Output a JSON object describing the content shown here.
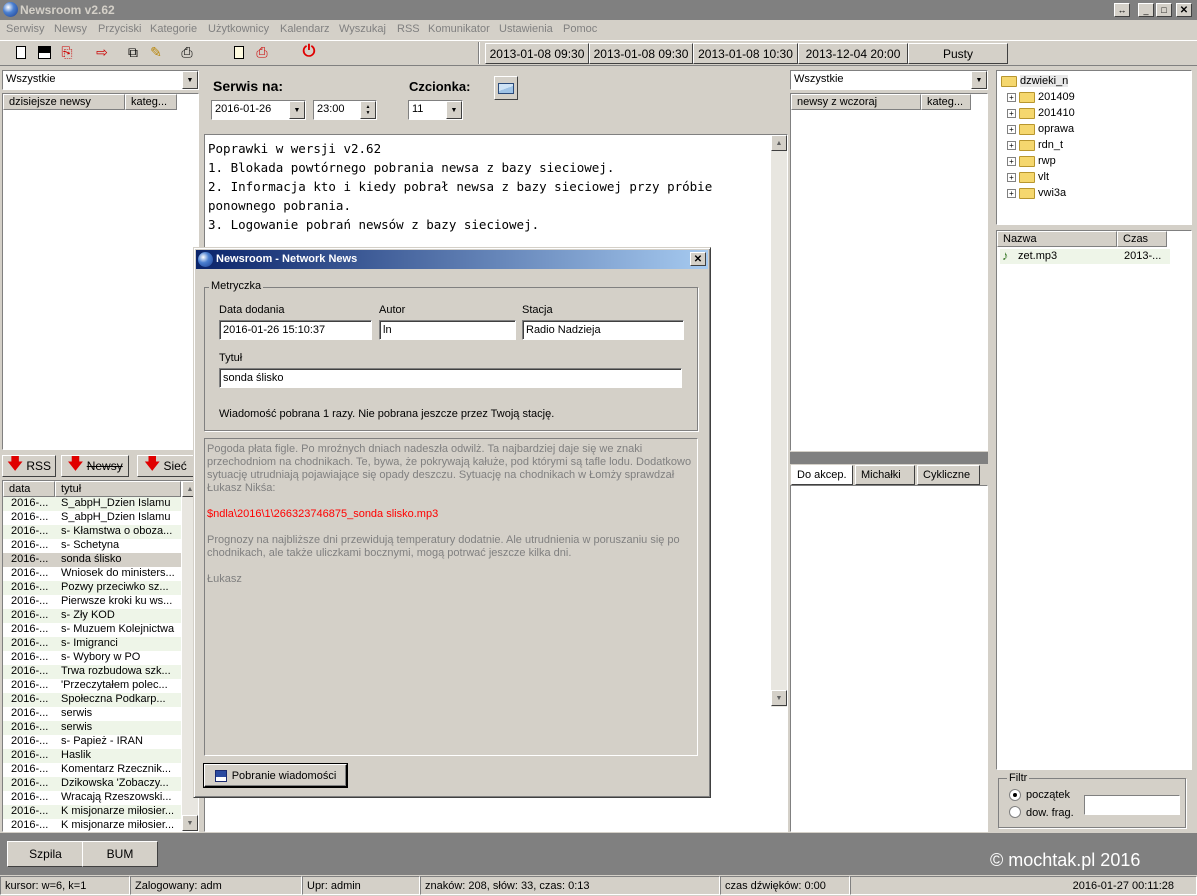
{
  "app": {
    "title": "Newsroom v2.62"
  },
  "menu": [
    "Serwisy",
    "Newsy",
    "Przyciski",
    "Kategorie",
    "Użytkownicy",
    "Kalendarz",
    "Wyszukaj",
    "RSS",
    "Komunikator",
    "Ustawienia",
    "Pomoc"
  ],
  "toolbar": {
    "dates": [
      "2013-01-08 09:30",
      "2013-01-08 09:30",
      "2013-01-08 10:30",
      "2013-12-04 20:00"
    ],
    "empty_label": "Pusty"
  },
  "left_panel": {
    "filter": "Wszystkie",
    "col_today": "dzisiejsze newsy",
    "col_category": "kateg...",
    "tabs": [
      "RSS",
      "Newsy",
      "Sieć"
    ],
    "list_headers": [
      "data",
      "tytuł"
    ],
    "rows": [
      {
        "date": "2016-...",
        "title": "S_abpH_Dzien Islamu"
      },
      {
        "date": "2016-...",
        "title": "S_abpH_Dzien Islamu"
      },
      {
        "date": "2016-...",
        "title": "s- Kłamstwa o oboza..."
      },
      {
        "date": "2016-...",
        "title": "s- Schetyna"
      },
      {
        "date": "2016-...",
        "title": "sonda ślisko"
      },
      {
        "date": "2016-...",
        "title": "Wniosek do ministers..."
      },
      {
        "date": "2016-...",
        "title": "Pozwy przeciwko sz..."
      },
      {
        "date": "2016-...",
        "title": "Pierwsze kroki ku ws..."
      },
      {
        "date": "2016-...",
        "title": "s- Zły KOD"
      },
      {
        "date": "2016-...",
        "title": "s- Muzuem Kolejnictwa"
      },
      {
        "date": "2016-...",
        "title": "s- Imigranci"
      },
      {
        "date": "2016-...",
        "title": "s- Wybory w PO"
      },
      {
        "date": "2016-...",
        "title": "Trwa rozbudowa szk..."
      },
      {
        "date": "2016-...",
        "title": "'Przeczytałem polec..."
      },
      {
        "date": "2016-...",
        "title": "Społeczna Podkarp..."
      },
      {
        "date": "2016-...",
        "title": "serwis"
      },
      {
        "date": "2016-...",
        "title": "serwis"
      },
      {
        "date": "2016-...",
        "title": "s- Papież - IRAN"
      },
      {
        "date": "2016-...",
        "title": "Haslik"
      },
      {
        "date": "2016-...",
        "title": "Komentarz Rzecznik..."
      },
      {
        "date": "2016-...",
        "title": "Dzikowska 'Zobaczy..."
      },
      {
        "date": "2016-...",
        "title": "Wracają Rzeszowski..."
      },
      {
        "date": "2016-...",
        "title": "K misjonarze miłosier..."
      },
      {
        "date": "2016-...",
        "title": "K misjonarze miłosier..."
      }
    ]
  },
  "center": {
    "service_label": "Serwis na:",
    "service_date": "2016-01-26",
    "service_time": "23:00",
    "font_label": "Czcionka:",
    "font_size": "11",
    "editor_lines": [
      "Poprawki w wersji v2.62",
      "1. Blokada powtórnego pobrania newsa z bazy sieciowej.",
      "2. Informacja kto i kiedy pobrał newsa z bazy sieciowej przy próbie",
      "ponownego pobrania.",
      "3. Logowanie pobrań newsów z bazy sieciowej."
    ]
  },
  "right_panel": {
    "filter": "Wszystkie",
    "col_yesterday": "newsy z wczoraj",
    "col_category": "kateg...",
    "tabs": [
      "Do akcep.",
      "Michałki",
      "Cykliczne"
    ]
  },
  "far_right": {
    "root_folder": "dzwieki_n",
    "folders": [
      "201409",
      "201410",
      "oprawa",
      "rdn_t",
      "rwp",
      "vlt",
      "vwi3a"
    ],
    "file_headers": [
      "Nazwa",
      "Czas"
    ],
    "files": [
      {
        "name": "zet.mp3",
        "time": "2013-..."
      }
    ],
    "filter_title": "Filtr",
    "filter_options": [
      "początek",
      "dow. frag."
    ]
  },
  "dialog": {
    "title": "Newsroom - Network News",
    "group": "Metryczka",
    "date_label": "Data dodania",
    "date_value": "2016-01-26 15:10:37",
    "author_label": "Autor",
    "author_value": "ln",
    "station_label": "Stacja",
    "station_value": "Radio Nadzieja",
    "title_label": "Tytuł",
    "title_value": "sonda ślisko",
    "info": "Wiadomość pobrana 1 razy. Nie pobrana jeszcze przez Twoją stację.",
    "body_p1": "Pogoda płata figle. Po mroźnych dniach nadeszła odwilż. Ta najbardziej daje się we znaki przechodniom na chodnikach. Te, bywa, że pokrywają kałuże, pod którymi są tafle lodu. Dodatkowo sytuację utrudniają pojawiające się opady deszczu. Sytuację na chodnikach w Łomży sprawdzał Łukasz Nikśa:",
    "body_link": "$ndla\\2016\\1\\266323746875_sonda slisko.mp3",
    "body_p2": "Prognozy na najbliższe dni przewidują temperatury dodatnie. Ale utrudnienia w poruszaniu się po chodnikach, ale także uliczkami bocznymi, mogą potrwać jeszcze kilka dni.",
    "body_p3": "Łukasz",
    "download_button": "Pobranie wiadomości"
  },
  "bottom": {
    "btn_szpila": "Szpila",
    "btn_bum": "BUM",
    "copyright": "© mochtak.pl 2016"
  },
  "status": {
    "cursor": "kursor: w=6, k=1",
    "user": "Zalogowany: adm",
    "rights": "Upr: admin",
    "counts": "znaków: 208, słów: 33, czas: 0:13",
    "sound_time": "czas dźwięków: 0:00",
    "clock": "2016-01-27 00:11:28"
  },
  "colors": {
    "titlebar": "#808080",
    "dialog_title_start": "#0a246a",
    "dialog_title_end": "#a6caf0",
    "link_red": "#ff0000",
    "row_alt": "#eef5e8",
    "selected_row": "#d4d0c8"
  }
}
